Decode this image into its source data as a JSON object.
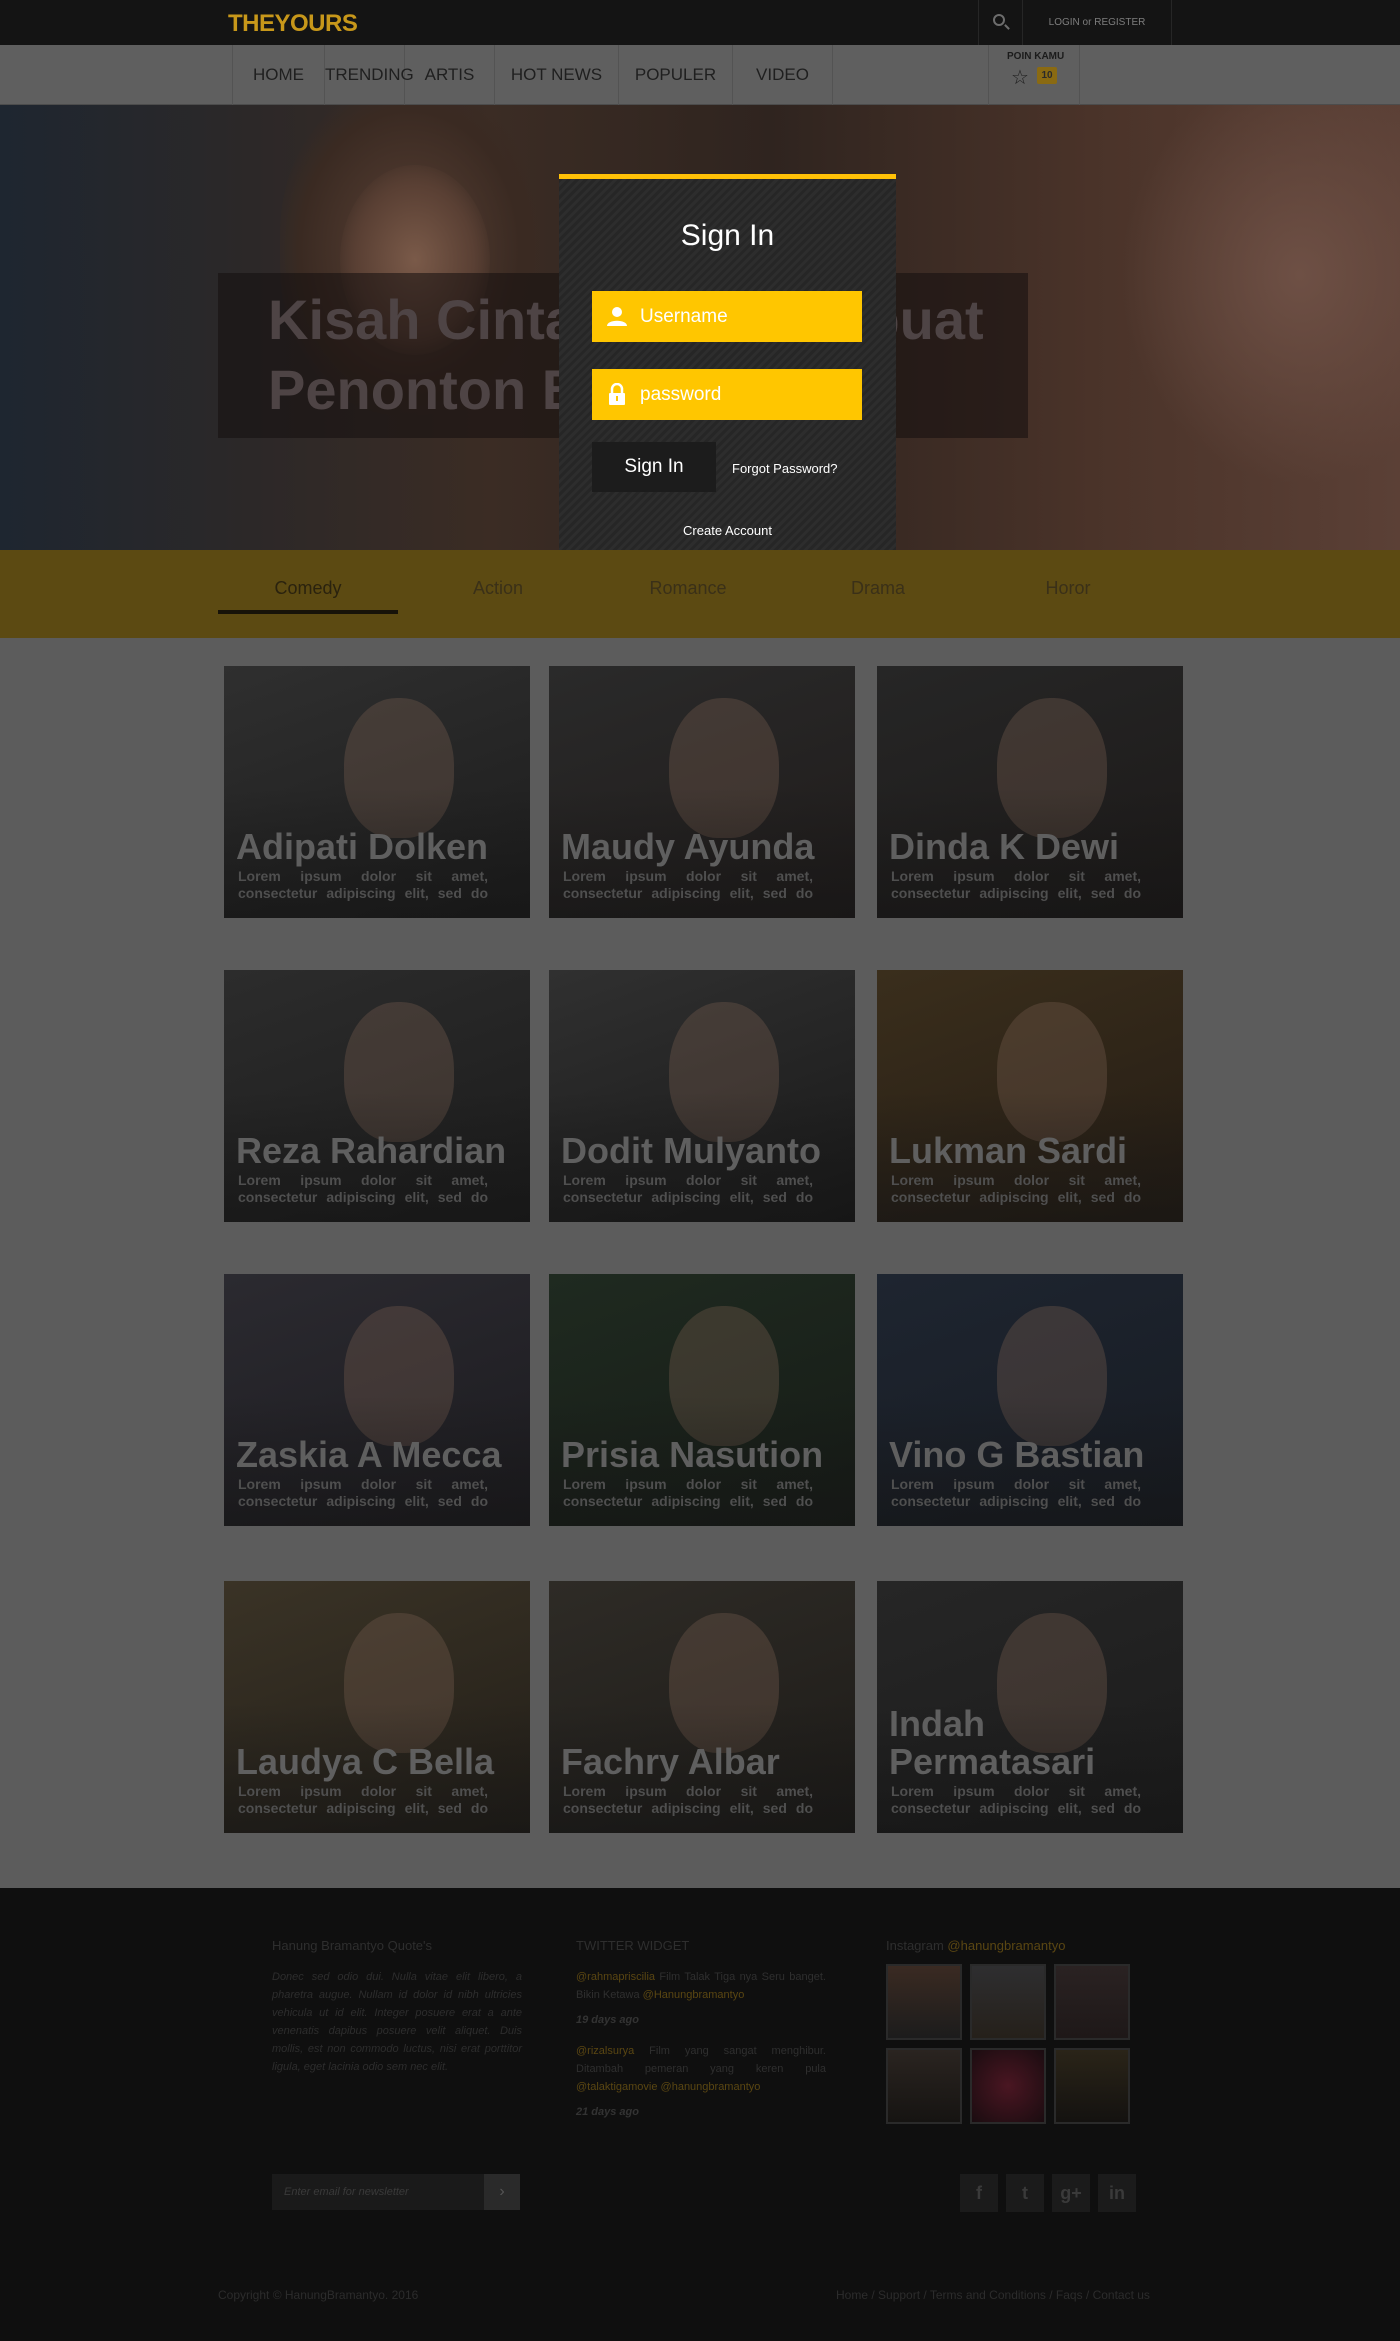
{
  "header": {
    "logo": "THEYOURS",
    "login_label": "LOGIN or REGISTER"
  },
  "nav": {
    "items": [
      {
        "label": "HOME"
      },
      {
        "label": "TRENDING"
      },
      {
        "label": "ARTIS"
      },
      {
        "label": "HOT NEWS"
      },
      {
        "label": "POPULER"
      },
      {
        "label": "VIDEO"
      }
    ],
    "poin_label": "POIN KAMU",
    "poin_value": "10"
  },
  "hero": {
    "title": "Kisah Cinta yang Membuat Penonton Bernostalgia"
  },
  "genres": {
    "tabs": [
      "Comedy",
      "Action",
      "Romance",
      "Drama",
      "Horor"
    ],
    "active": "Comedy"
  },
  "cards": [
    {
      "name": "Adipati Dolken",
      "desc": "Lorem ipsum dolor sit amet, consectetur adipiscing elit, sed do"
    },
    {
      "name": "Maudy Ayunda",
      "desc": "Lorem ipsum dolor sit amet, consectetur adipiscing elit, sed do"
    },
    {
      "name": "Dinda K Dewi",
      "desc": "Lorem ipsum dolor sit amet, consectetur adipiscing elit, sed do"
    },
    {
      "name": "Reza Rahardian",
      "desc": "Lorem ipsum dolor sit amet, consectetur adipiscing elit, sed do"
    },
    {
      "name": "Dodit Mulyanto",
      "desc": "Lorem ipsum dolor sit amet, consectetur adipiscing elit, sed do"
    },
    {
      "name": "Lukman Sardi",
      "desc": "Lorem ipsum dolor sit amet, consectetur adipiscing elit, sed do"
    },
    {
      "name": "Zaskia A Mecca",
      "desc": "Lorem ipsum dolor sit amet, consectetur adipiscing elit, sed do"
    },
    {
      "name": "Prisia Nasution",
      "desc": "Lorem ipsum dolor sit amet, consectetur adipiscing elit, sed do"
    },
    {
      "name": "Vino G Bastian",
      "desc": "Lorem ipsum dolor sit amet, consectetur adipiscing elit, sed do"
    },
    {
      "name": "Laudya C Bella",
      "desc": "Lorem ipsum dolor sit amet, consectetur adipiscing elit, sed do"
    },
    {
      "name": "Fachry Albar",
      "desc": "Lorem ipsum dolor sit amet, consectetur adipiscing elit, sed do"
    },
    {
      "name": "Indah Permatasari",
      "desc": "Lorem ipsum dolor sit amet, consectetur adipiscing elit, sed do"
    }
  ],
  "footer": {
    "quote_title": "Hanung Bramantyo Quote's",
    "quote_text": "Donec sed odio dui. Nulla vitae elit libero, a pharetra augue. Nullam id dolor id nibh ultricies vehicula ut id elit. Integer posuere erat a ante venenatis dapibus posuere velit aliquet. Duis mollis, est non commodo luctus, nisi erat porttitor ligula, eget lacinia odio sem nec elit.",
    "twitter_title": "TWITTER WIDGET",
    "tweets": [
      {
        "handle": "@rahmapriscilia",
        "text": " Film Talak Tiga nya Seru banget. Bikin Ketawa ",
        "mention": "@Hanungbramantyo",
        "time": "19 days ago"
      },
      {
        "handle": "@rizalsurya",
        "text": " Film yang sangat menghibur. Ditambah pemeran yang keren pula ",
        "mention": "@talaktigamovie @hanungbramantyo",
        "time": "21 days ago"
      }
    ],
    "instagram_prefix": "Instagram ",
    "instagram_handle": "@hanungbramantyo",
    "newsletter_placeholder": "Enter email for newsletter",
    "newsletter_button": "›",
    "socials": [
      "f",
      "t",
      "g+",
      "in"
    ],
    "copyright": "Copyright © HanungBramantyo. 2016",
    "links": "Home / Support / Terms and Conditions / Faqs / Contact us"
  },
  "modal": {
    "title": "Sign In",
    "username_placeholder": "Username",
    "password_placeholder": "password",
    "signin_button": "Sign In",
    "forgot": "Forgot Password?",
    "create": "Create Account"
  },
  "colors": {
    "accent": "#ffc600",
    "modal_border": "#ffc107"
  }
}
